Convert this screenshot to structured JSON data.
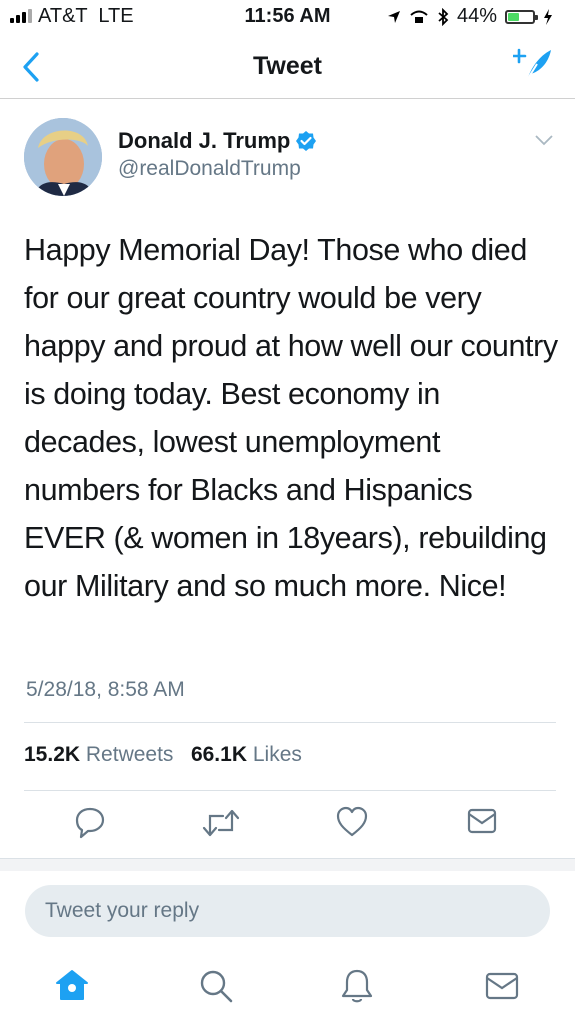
{
  "status_bar": {
    "carrier": "AT&T  LTE",
    "time": "11:56 AM",
    "battery_pct": "44%",
    "battery_level": 0.44
  },
  "nav": {
    "title": "Tweet"
  },
  "tweet": {
    "author_name": "Donald J. Trump",
    "handle": "@realDonaldTrump",
    "text": "Happy Memorial Day! Those who died for our great country would be very happy and proud at how well our country is doing today. Best economy in decades, lowest unemployment numbers for Blacks and Hispanics EVER (& women in 18years), rebuilding our Military and so much more. Nice!",
    "timestamp": "5/28/18, 8:58 AM",
    "retweets_count": "15.2K",
    "retweets_label": "Retweets",
    "likes_count": "66.1K",
    "likes_label": "Likes"
  },
  "reply": {
    "placeholder": "Tweet your reply"
  },
  "colors": {
    "accent": "#1da1f2",
    "muted": "#657786",
    "battery": "#4cd964"
  },
  "icons": [
    "back-chevron-icon",
    "compose-tweet-icon",
    "verified-badge-icon",
    "caret-down-icon",
    "reply-icon",
    "retweet-icon",
    "like-icon",
    "dm-icon",
    "home-icon",
    "search-icon",
    "notifications-icon",
    "messages-icon"
  ]
}
